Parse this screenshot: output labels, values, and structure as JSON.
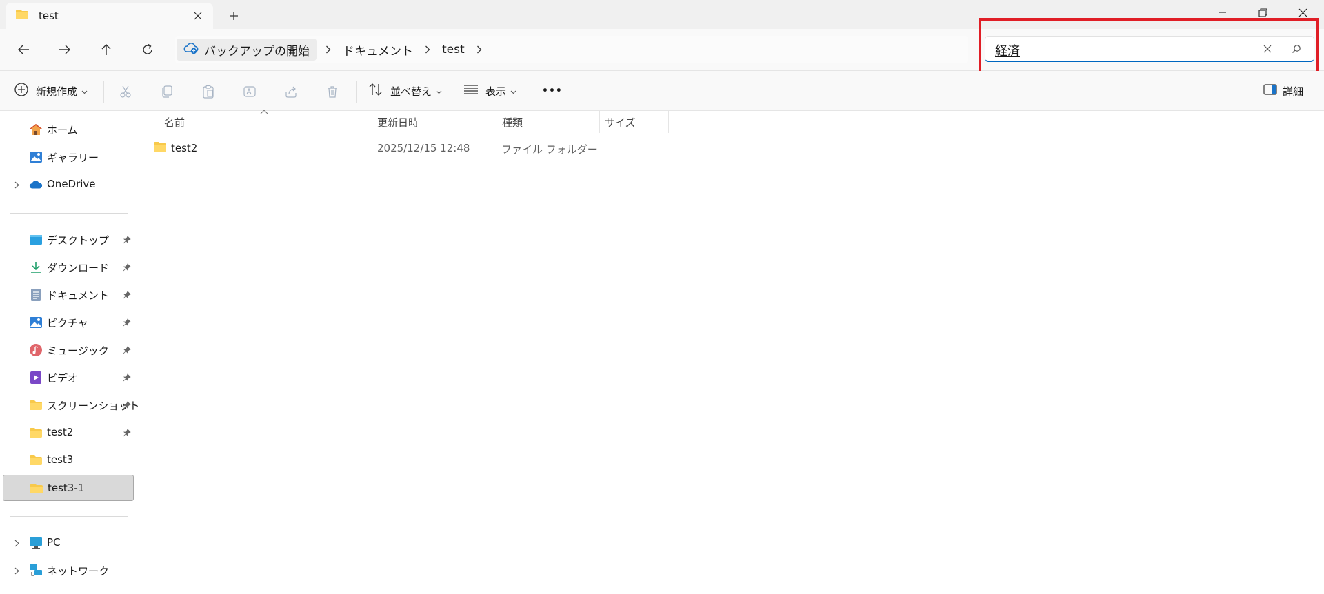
{
  "window": {
    "tab_title": "test",
    "new_tab_icon": "plus-icon",
    "controls": [
      "minimize-icon",
      "restore-icon",
      "close-icon"
    ]
  },
  "addressbar": {
    "breadcrumb": {
      "backup_label": "バックアップの開始",
      "items": [
        "ドキュメント",
        "test"
      ]
    },
    "search": {
      "value": "経済"
    }
  },
  "commandbar": {
    "new_label": "新規作成",
    "sort_label": "並べ替え",
    "view_label": "表示",
    "more_label": "•••",
    "details_label": "詳細"
  },
  "sidebar": {
    "top": [
      {
        "label": "ホーム",
        "icon": "home-icon"
      },
      {
        "label": "ギャラリー",
        "icon": "gallery-icon"
      },
      {
        "label": "OneDrive",
        "icon": "onedrive-icon"
      }
    ],
    "quick": [
      {
        "label": "デスクトップ",
        "icon": "desktop-icon"
      },
      {
        "label": "ダウンロード",
        "icon": "download-icon"
      },
      {
        "label": "ドキュメント",
        "icon": "document-icon"
      },
      {
        "label": "ピクチャ",
        "icon": "pictures-icon"
      },
      {
        "label": "ミュージック",
        "icon": "music-icon"
      },
      {
        "label": "ビデオ",
        "icon": "video-icon"
      },
      {
        "label": "スクリーンショット",
        "icon": "folder-icon"
      },
      {
        "label": "test2",
        "icon": "folder-icon"
      },
      {
        "label": "test3",
        "icon": "folder-icon"
      },
      {
        "label": "test3-1",
        "icon": "folder-icon"
      }
    ],
    "bottom": [
      {
        "label": "PC",
        "icon": "pc-icon"
      },
      {
        "label": "ネットワーク",
        "icon": "network-icon"
      }
    ]
  },
  "filelist": {
    "columns": [
      "名前",
      "更新日時",
      "種類",
      "サイズ"
    ],
    "rows": [
      {
        "name": "test2",
        "modified": "2025/12/15 12:48",
        "type": "ファイル フォルダー",
        "size": ""
      }
    ]
  },
  "colors": {
    "accent": "#0067c0",
    "highlight_box": "#e01e26",
    "folder": "#f8c94a"
  }
}
